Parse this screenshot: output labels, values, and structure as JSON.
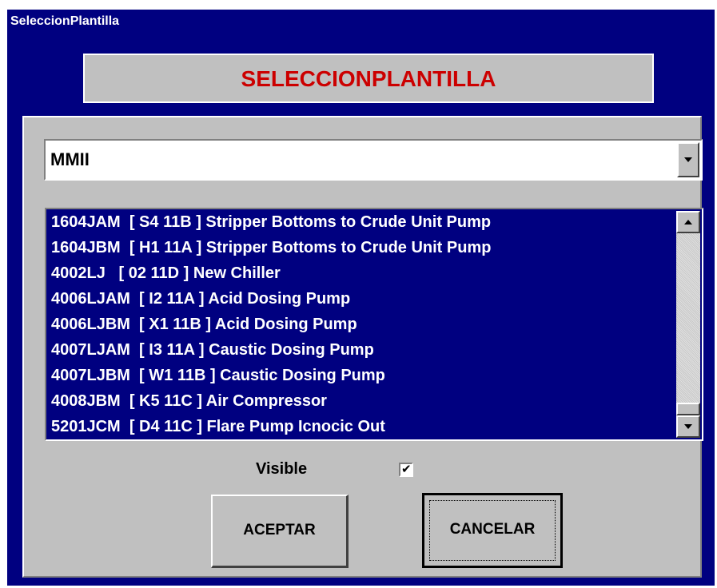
{
  "window": {
    "title": "SeleccionPlantilla"
  },
  "header": {
    "label": "SELECCIONPLANTILLA",
    "label_color": "#cc0000"
  },
  "combo": {
    "selected_value": "MMII"
  },
  "list": {
    "items": [
      "1604JAM  [ S4 11B ] Stripper Bottoms to Crude Unit Pump",
      "1604JBM  [ H1 11A ] Stripper Bottoms to Crude Unit Pump",
      "4002LJ   [ 02 11D ] New Chiller",
      "4006LJAM  [ I2 11A ] Acid Dosing Pump",
      "4006LJBM  [ X1 11B ] Acid Dosing Pump",
      "4007LJAM  [ I3 11A ] Caustic Dosing Pump",
      "4007LJBM  [ W1 11B ] Caustic Dosing Pump",
      "4008JBM  [ K5 11C ] Air Compressor",
      "5201JCM  [ D4 11C ] Flare Pump Icnocic Out"
    ],
    "selection_color": "#000080"
  },
  "options": {
    "visible_label": "Visible",
    "visible_checked": true
  },
  "buttons": {
    "accept_label": "ACEPTAR",
    "cancel_label": "CANCELAR"
  },
  "icons": {
    "combo_dropdown": "chevron-down-icon",
    "scroll_up": "arrow-up-icon",
    "scroll_down": "arrow-down-icon",
    "checkbox_mark": "checkmark-icon"
  }
}
